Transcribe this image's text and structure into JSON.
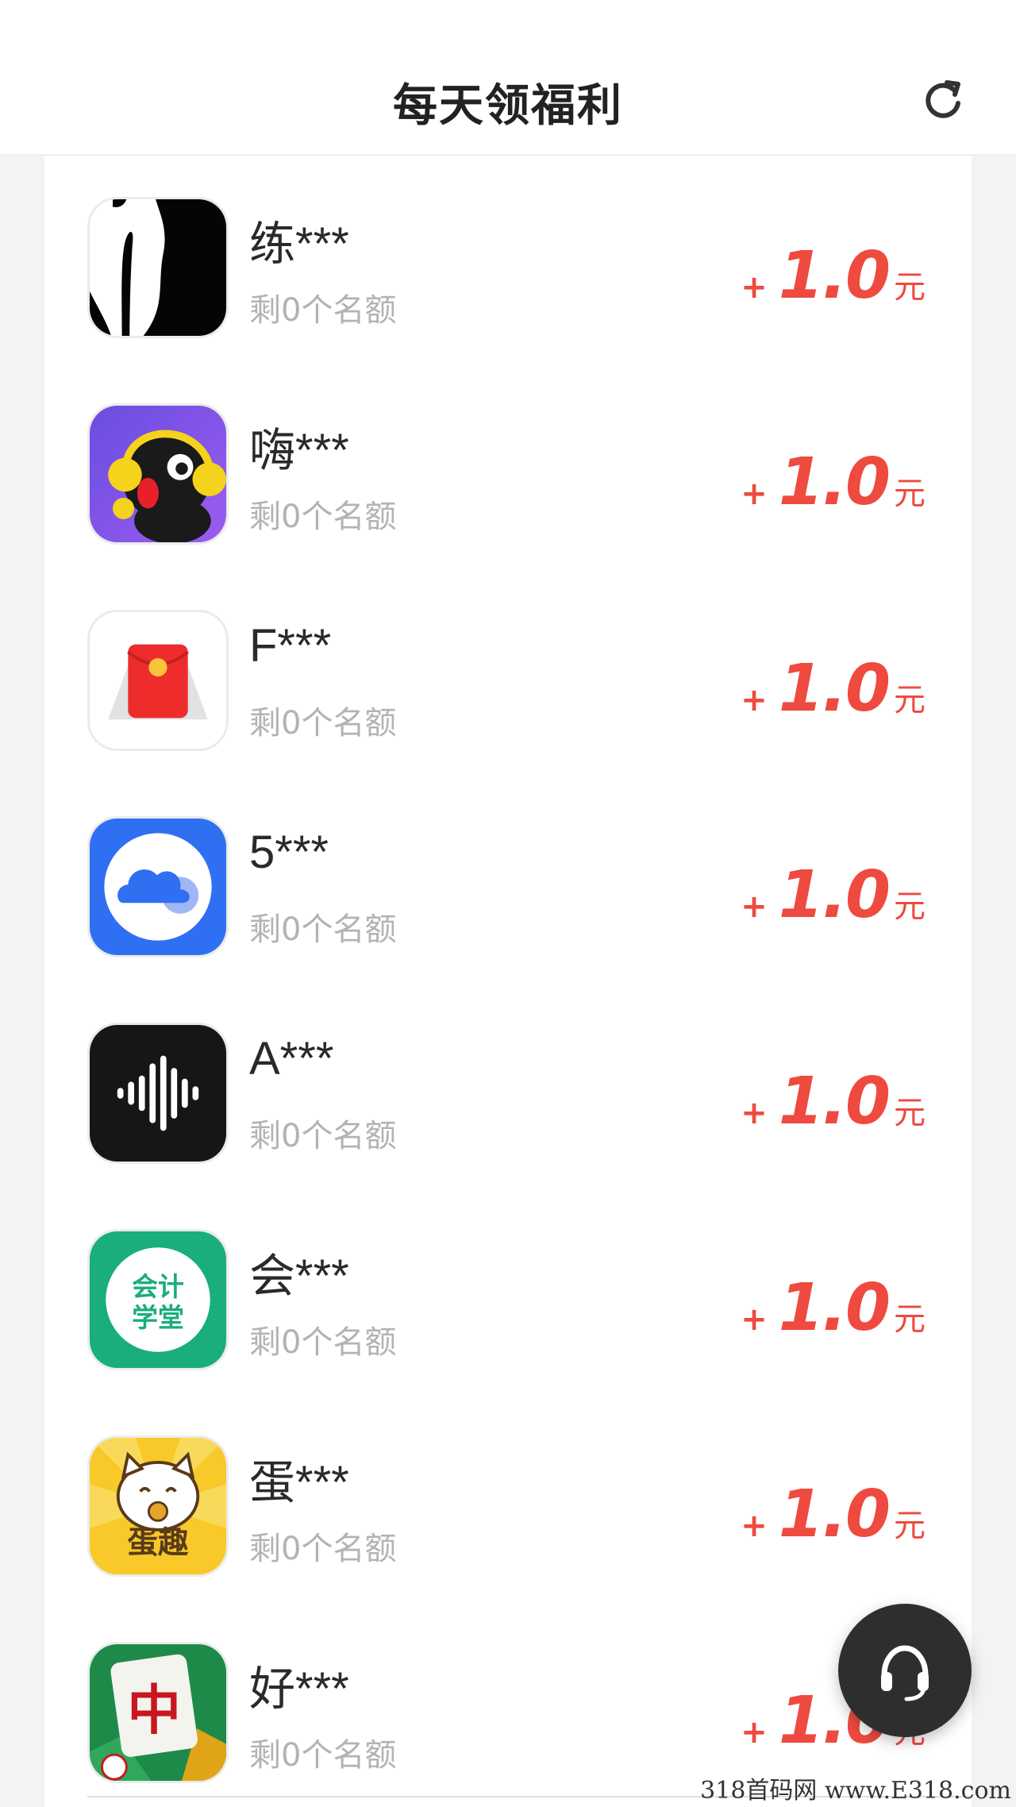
{
  "header": {
    "title": "每天领福利",
    "refresh_icon": "refresh-icon"
  },
  "offers": [
    {
      "name": "练***",
      "quota": "剩0个名额",
      "plus": "+",
      "amount": "1.0",
      "unit": "元",
      "icon": "brush-pen-app-icon"
    },
    {
      "name": "嗨***",
      "quota": "剩0个名额",
      "plus": "+",
      "amount": "1.0",
      "unit": "元",
      "icon": "singing-bird-app-icon"
    },
    {
      "name": "F***",
      "quota": "剩0个名额",
      "plus": "+",
      "amount": "1.0",
      "unit": "元",
      "icon": "red-envelope-app-icon"
    },
    {
      "name": "5***",
      "quota": "剩0个名额",
      "plus": "+",
      "amount": "1.0",
      "unit": "元",
      "icon": "cloud-app-icon"
    },
    {
      "name": "A***",
      "quota": "剩0个名额",
      "plus": "+",
      "amount": "1.0",
      "unit": "元",
      "icon": "soundwave-app-icon"
    },
    {
      "name": "会***",
      "quota": "剩0个名额",
      "plus": "+",
      "amount": "1.0",
      "unit": "元",
      "icon": "accounting-school-app-icon",
      "icon_text": [
        "会计",
        "学堂"
      ]
    },
    {
      "name": "蛋***",
      "quota": "剩0个名额",
      "plus": "+",
      "amount": "1.0",
      "unit": "元",
      "icon": "lucky-cat-app-icon",
      "icon_text": "蛋趣"
    },
    {
      "name": "好***",
      "quota": "剩0个名额",
      "plus": "+",
      "amount": "1.0",
      "unit": "元",
      "icon": "mahjong-app-icon",
      "icon_text": "中"
    }
  ],
  "support": {
    "icon": "headset-icon"
  },
  "watermark": "318首码网 www.E318.com",
  "colors": {
    "accent": "#ee4a3f",
    "quota": "#b3b3b3",
    "background": "#f3f3f3"
  }
}
